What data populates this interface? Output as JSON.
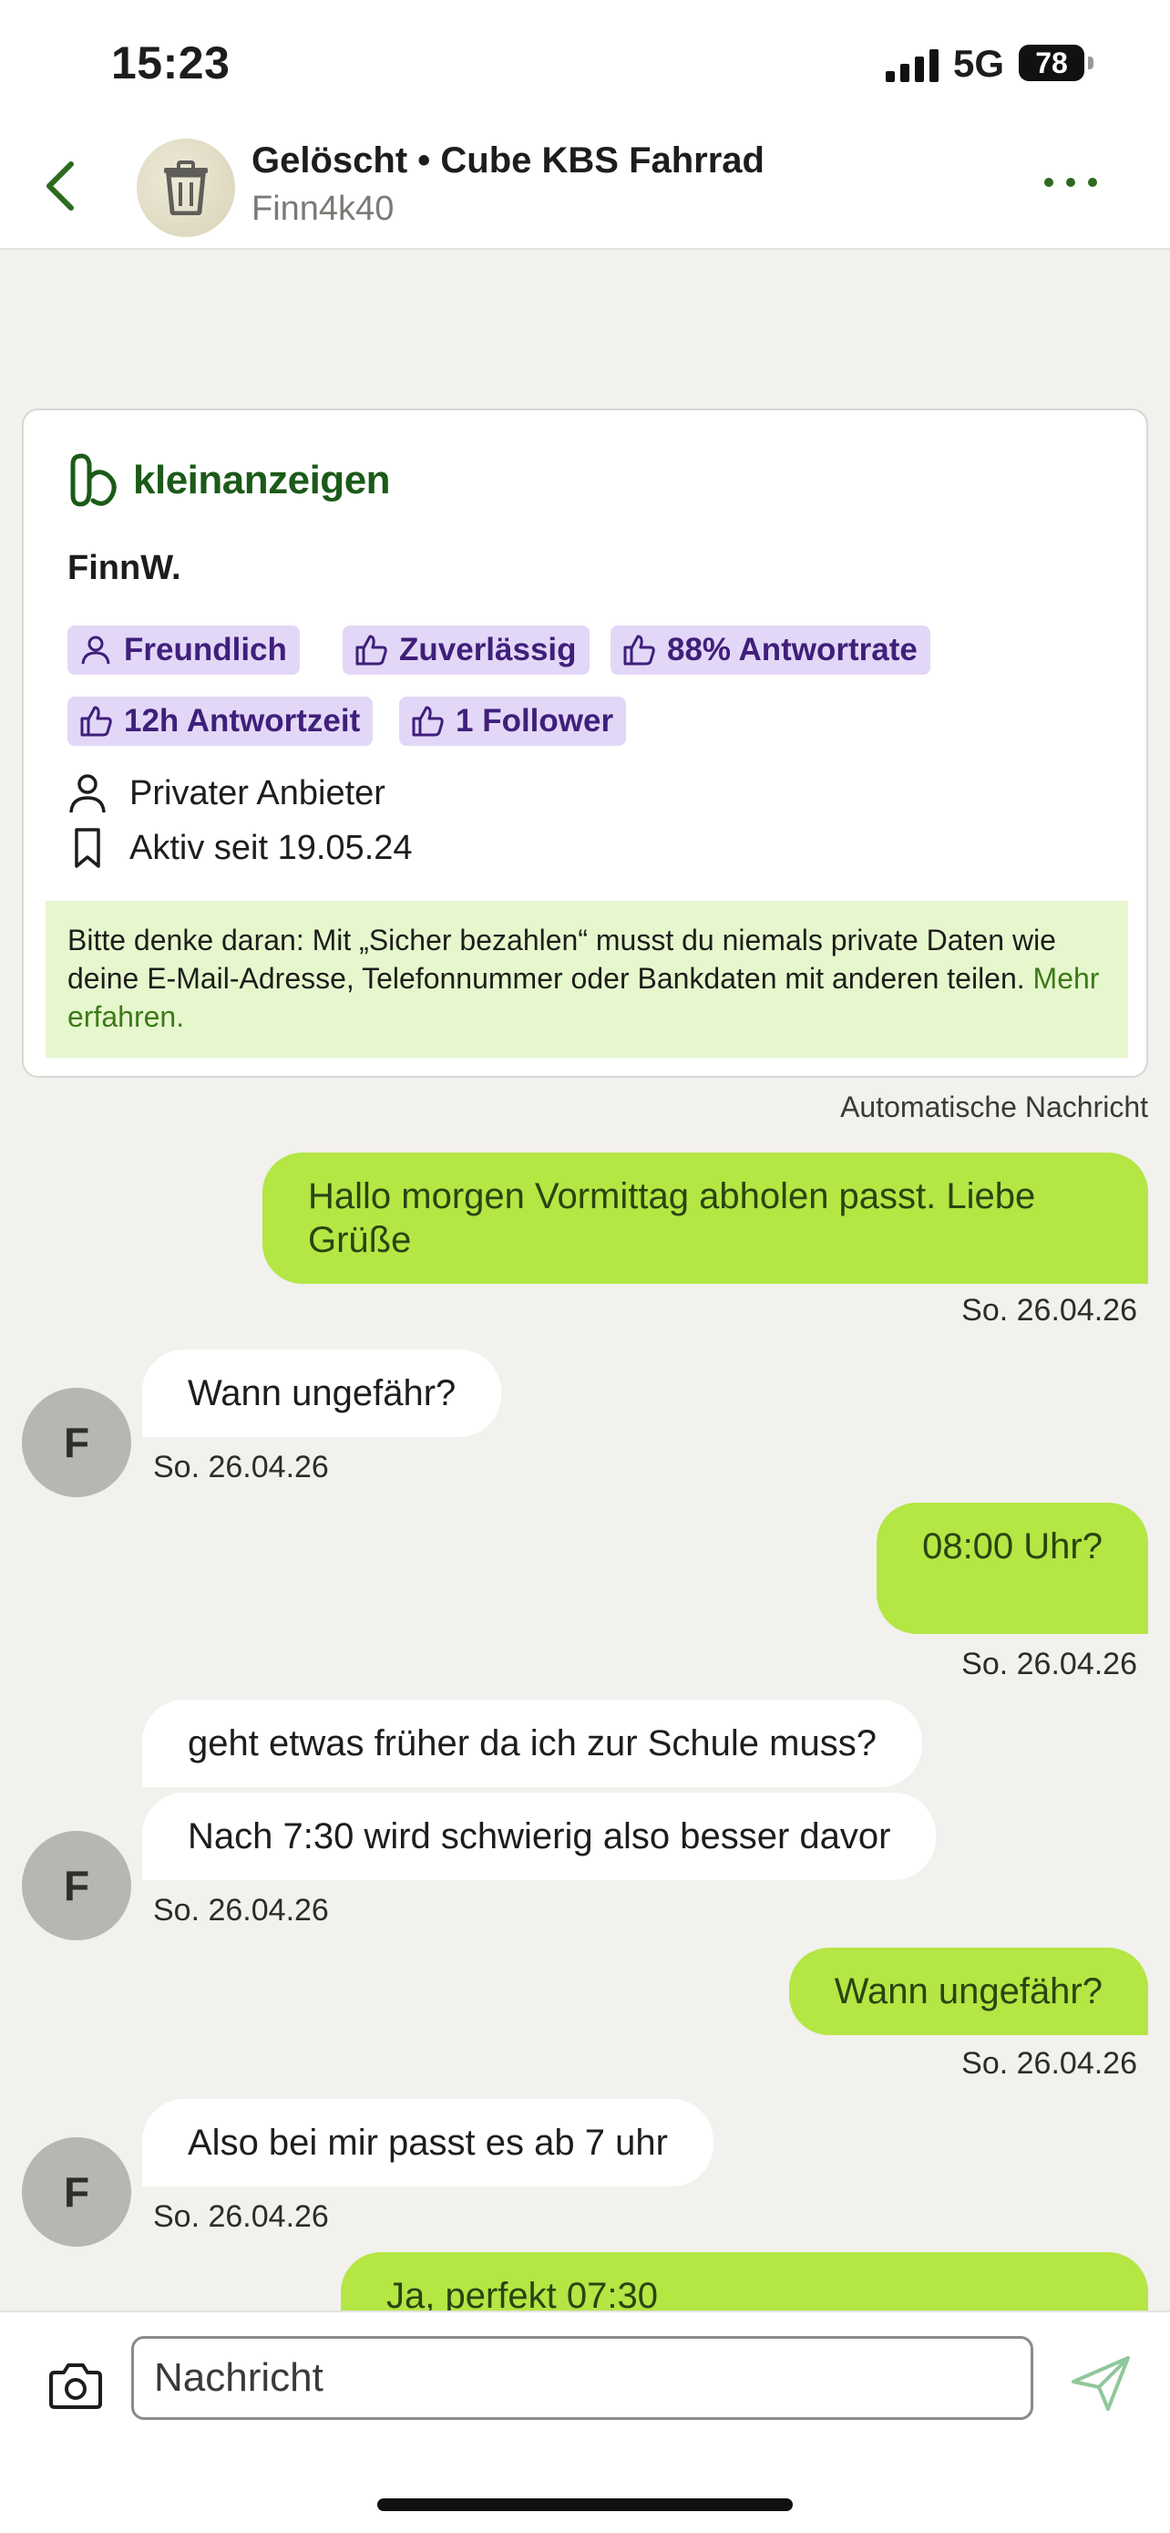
{
  "status_bar": {
    "time": "15:23",
    "network": "5G",
    "battery": "78"
  },
  "header": {
    "title": "Gelöscht • Cube KBS Fahrrad",
    "subtitle": "Finn4k40",
    "back_icon": "chevron-left-icon",
    "more_icon": "ellipsis-icon"
  },
  "card": {
    "logo_text": "kleinanzeigen",
    "seller_name": "FinnW.",
    "badges": [
      {
        "label": "Freundlich",
        "icon": "person-icon"
      },
      {
        "label": "Zuverlässig",
        "icon": "thumbs-up-icon"
      },
      {
        "label": "88% Antwortrate",
        "icon": "thumbs-up-icon"
      },
      {
        "label": "12h Antwortzeit",
        "icon": "thumbs-up-icon"
      },
      {
        "label": "1 Follower",
        "icon": "thumbs-up-icon"
      }
    ],
    "seller_type": "Privater Anbieter",
    "active_since": "Aktiv seit 19.05.24",
    "notice_text": "Bitte denke daran: Mit „Sicher bezahlen“ musst du niemals private Daten wie deine E-Mail-Adresse, Telefonnummer oder Bankdaten mit anderen teilen.",
    "notice_link": "Mehr erfahren."
  },
  "auto_label": "Automatische Nachricht",
  "messages": [
    {
      "dir": "out",
      "lines": [
        "Hallo morgen Vormittag abholen passt. Liebe",
        "Grüße"
      ],
      "time": "So. 26.04.26"
    },
    {
      "dir": "in",
      "text": "Wann ungefähr?",
      "time": "So. 26.04.26",
      "avatar": "F"
    },
    {
      "dir": "out",
      "text": "08:00 Uhr?",
      "time": "So. 26.04.26"
    },
    {
      "dir": "in",
      "text": "geht etwas früher da ich zur Schule muss?"
    },
    {
      "dir": "in",
      "text": "Nach 7:30 wird schwierig also besser davor",
      "time": "So. 26.04.26",
      "avatar": "F"
    },
    {
      "dir": "out",
      "text": "Wann ungefähr?",
      "time": "So. 26.04.26"
    },
    {
      "dir": "in",
      "text": "Also bei mir passt es ab 7 uhr",
      "time": "So. 26.04.26",
      "avatar": "F"
    },
    {
      "dir": "out",
      "text": "Ja, perfekt 07:30"
    }
  ],
  "composer": {
    "placeholder": "Nachricht",
    "camera_icon": "camera-icon",
    "send_icon": "send-icon"
  },
  "colors": {
    "accent_green": "#b4e644",
    "brand_green": "#1b5a18",
    "badge_purple": "#e3d7f7"
  }
}
